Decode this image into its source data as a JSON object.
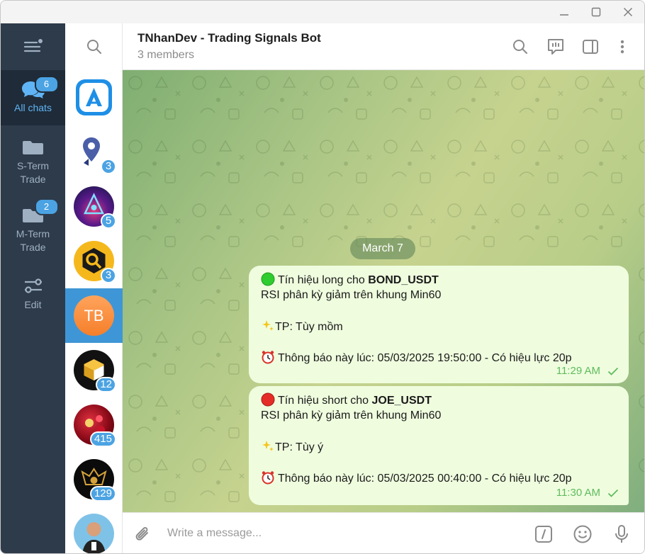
{
  "window": {
    "controls": [
      "minimize",
      "maximize",
      "close"
    ]
  },
  "folders": [
    {
      "label": "All chats",
      "badge": "6",
      "active": true,
      "icon": "chats-icon"
    },
    {
      "label": "S-Term\nTrade",
      "badge": "",
      "active": false,
      "icon": "folder-icon"
    },
    {
      "label": "M-Term\nTrade",
      "badge": "2",
      "active": false,
      "icon": "folder-icon"
    },
    {
      "label": "Edit",
      "badge": "",
      "active": false,
      "icon": "sliders-icon"
    }
  ],
  "chats": [
    {
      "avatar": "app-logo",
      "badge": ""
    },
    {
      "avatar": "location-pin",
      "badge": "3"
    },
    {
      "avatar": "neon-logo",
      "badge": "5"
    },
    {
      "avatar": "hex-logo",
      "badge": "3"
    },
    {
      "avatar": "initials",
      "initials": "TB",
      "badge": "",
      "selected": true
    },
    {
      "avatar": "cube-logo",
      "badge": "12"
    },
    {
      "avatar": "roses",
      "badge": "415"
    },
    {
      "avatar": "gold-emblem",
      "badge": "129"
    },
    {
      "avatar": "person",
      "badge": ""
    }
  ],
  "header": {
    "title": "TNhanDev - Trading Signals Bot",
    "subtitle": "3 members"
  },
  "date_pill": "March 7",
  "messages": [
    {
      "dot_color": "#2ecc2e",
      "line1_prefix": "Tín hiệu long cho ",
      "line1_bold": "BOND_USDT",
      "line2": "RSI phân kỳ giảm trên khung Min60",
      "line3": "TP: Tùy mồm",
      "line4": "Thông báo này lúc: 05/03/2025 19:50:00 - Có hiệu lực 20p",
      "time": "11:29 AM"
    },
    {
      "dot_color": "#e52d27",
      "line1_prefix": "Tín hiệu short cho ",
      "line1_bold": "JOE_USDT",
      "line2": "RSI phân kỳ giảm trên khung Min60",
      "line3": "TP: Tùy ý",
      "line4": "Thông báo này lúc: 05/03/2025 00:40:00 - Có hiệu lực 20p",
      "time": "11:30 AM"
    }
  ],
  "composer": {
    "placeholder": "Write a message..."
  }
}
